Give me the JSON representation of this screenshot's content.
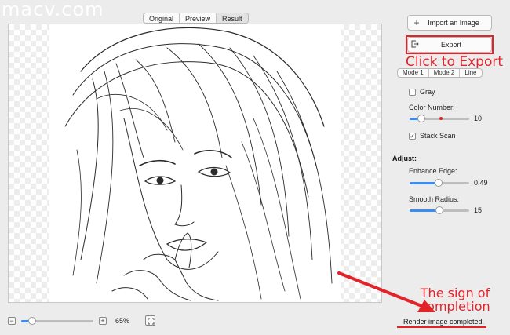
{
  "watermark": "macv.com",
  "view_tabs": [
    "Original",
    "Preview",
    "Result"
  ],
  "active_tab": "Result",
  "panel": {
    "import_label": "Import an Image",
    "export_label": "Export",
    "modes": [
      "Mode 1",
      "Mode 2",
      "Line"
    ],
    "gray_label": "Gray",
    "gray_checked": false,
    "color_number_label": "Color Number:",
    "color_number_value": "10",
    "stack_scan_label": "Stack Scan",
    "stack_scan_checked": true,
    "adjust_label": "Adjust:",
    "enhance_edge_label": "Enhance Edge:",
    "enhance_edge_value": "0.49",
    "smooth_radius_label": "Smooth Radius:",
    "smooth_radius_value": "15"
  },
  "bottom": {
    "zoom_value": "65%",
    "zoom_fraction": 0.15,
    "status": "Render image completed."
  },
  "annotations": {
    "click_to_export": "Click to Export",
    "sign_of_completion": "The sign of completion"
  },
  "colors": {
    "annotation": "#e2242a",
    "slider_fill": "#3b8cf0"
  }
}
